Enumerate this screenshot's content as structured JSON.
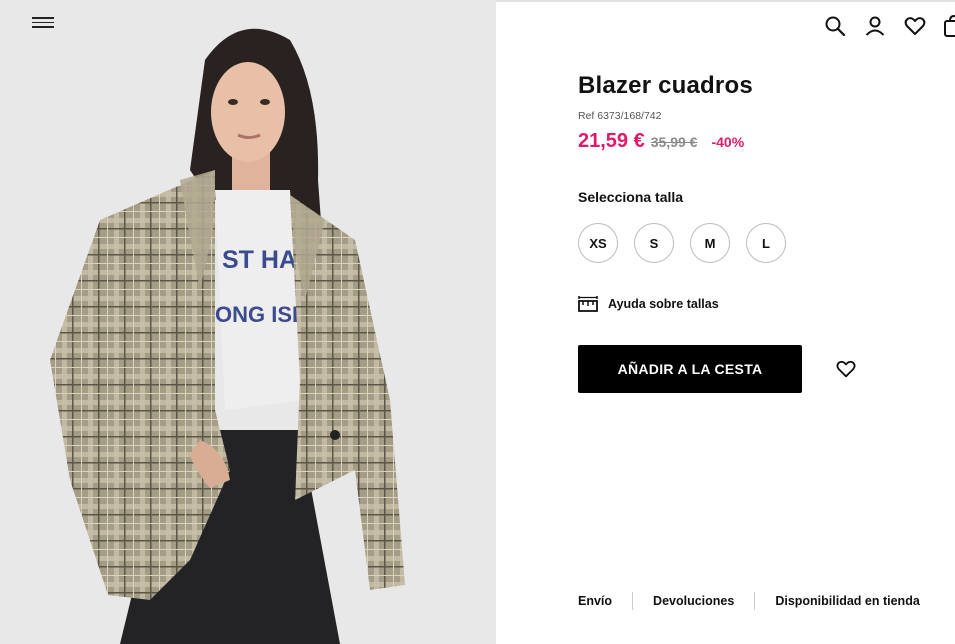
{
  "header": {
    "icons": [
      "search-icon",
      "user-icon",
      "heart-icon",
      "bag-icon"
    ]
  },
  "product": {
    "title": "Blazer cuadros",
    "ref": "Ref 6373/168/742",
    "price_now": "21,59 €",
    "price_old": "35,99 €",
    "discount": "-40%",
    "sale_color": "#e0196b"
  },
  "sizes": {
    "heading": "Selecciona talla",
    "options": [
      "XS",
      "S",
      "M",
      "L"
    ]
  },
  "size_help": {
    "label": "Ayuda sobre tallas"
  },
  "cart": {
    "add_label": "AÑADIR A LA CESTA"
  },
  "footer": {
    "links": [
      "Envío",
      "Devoluciones",
      "Disponibilidad en tienda"
    ]
  },
  "photo": {
    "shirt_text": [
      "ST HAMP",
      "ONG ISLA"
    ]
  }
}
